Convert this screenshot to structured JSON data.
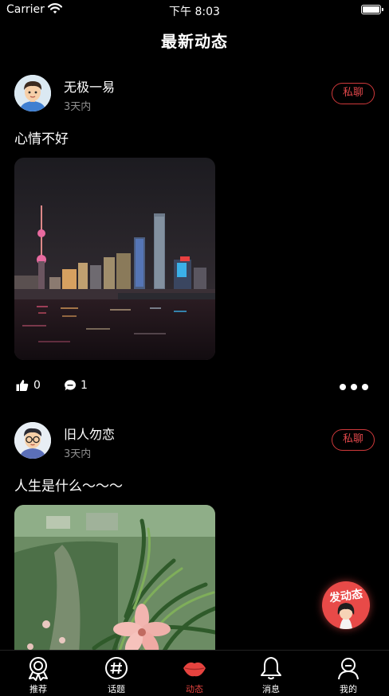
{
  "status_bar": {
    "carrier": "Carrier",
    "time": "下午 8:03"
  },
  "nav": {
    "title": "最新动态"
  },
  "posts": [
    {
      "username": "无极一易",
      "time": "3天内",
      "dm_label": "私聊",
      "text": "心情不好",
      "likes": "0",
      "comments": "1"
    },
    {
      "username": "旧人勿恋",
      "time": "3天内",
      "dm_label": "私聊",
      "text": "人生是什么～～～"
    }
  ],
  "fab": {
    "label": "发动态"
  },
  "tabbar": {
    "items": [
      {
        "label": "推荐",
        "icon": "badge-icon"
      },
      {
        "label": "话题",
        "icon": "hashtag-icon"
      },
      {
        "label": "动态",
        "icon": "lips-icon",
        "active": true
      },
      {
        "label": "消息",
        "icon": "bell-icon"
      },
      {
        "label": "我的",
        "icon": "person-icon"
      }
    ]
  },
  "colors": {
    "accent": "#e6433f",
    "background": "#000000",
    "muted_text": "#8e8e8e"
  }
}
